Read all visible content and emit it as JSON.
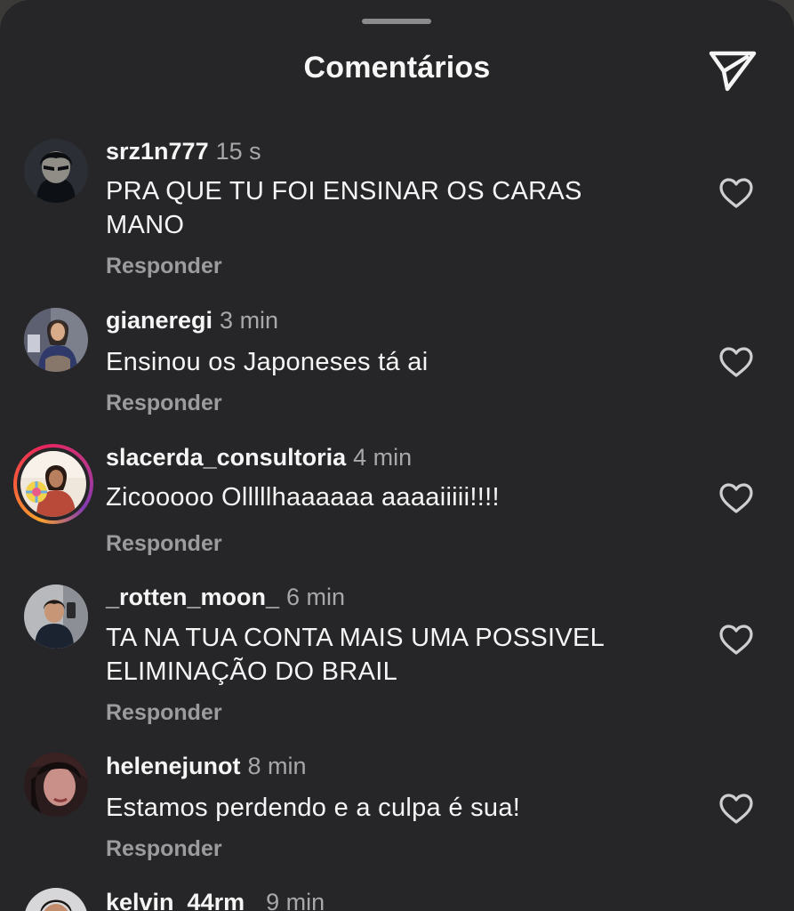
{
  "header": {
    "title": "Comentários",
    "send_icon": "paper-plane-icon"
  },
  "comments": [
    {
      "username": "srz1n777",
      "time": "15 s",
      "text": "PRA QUE TU FOI ENSINAR OS CARAS MANO",
      "reply_label": "Responder",
      "like_icon": "heart-outline-icon"
    },
    {
      "username": "gianeregi",
      "time": "3 min",
      "text": "Ensinou os Japoneses tá ai",
      "reply_label": "Responder",
      "like_icon": "heart-outline-icon"
    },
    {
      "username": "slacerda_consultoria",
      "time": "4 min",
      "text": "Zicooooo Olllllhaaaaaa aaaaiiiii!!!!",
      "reply_label": "Responder",
      "like_icon": "heart-outline-icon",
      "has_story": true
    },
    {
      "username": "_rotten_moon_",
      "time": "6 min",
      "text": "TA NA TUA CONTA MAIS UMA POSSIVEL ELIMINAÇÃO DO BRAIL",
      "reply_label": "Responder",
      "like_icon": "heart-outline-icon"
    },
    {
      "username": "helenejunot",
      "time": "8 min",
      "text": "Estamos perdendo e a culpa é sua!",
      "reply_label": "Responder",
      "like_icon": "heart-outline-icon"
    },
    {
      "username": "kelvin_44rm",
      "time": "9 min"
    }
  ],
  "colors": {
    "background": "#262628",
    "text": "#f5f5f5",
    "muted": "#a8a8aa",
    "reply": "#9c9c9e"
  }
}
